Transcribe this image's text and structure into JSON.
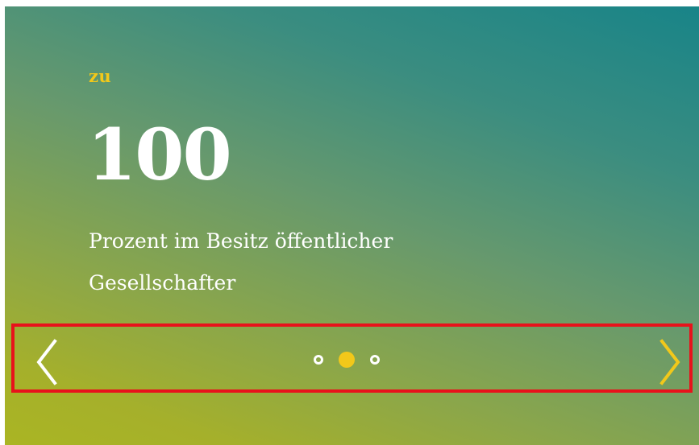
{
  "slide": {
    "prefix": "zu",
    "value": "100",
    "description_line1": "Prozent im Besitz öffentlicher",
    "description_line2": "Gesellschafter"
  },
  "carousel": {
    "slide_count": 3,
    "active_index": 1,
    "prev_icon": "chevron-left-icon",
    "next_icon": "chevron-right-icon"
  },
  "colors": {
    "accent": "#f2c81a",
    "text": "#ffffff",
    "highlight_border": "#e8121b",
    "gradient_top": "#188488",
    "gradient_bottom": "#aab523"
  }
}
